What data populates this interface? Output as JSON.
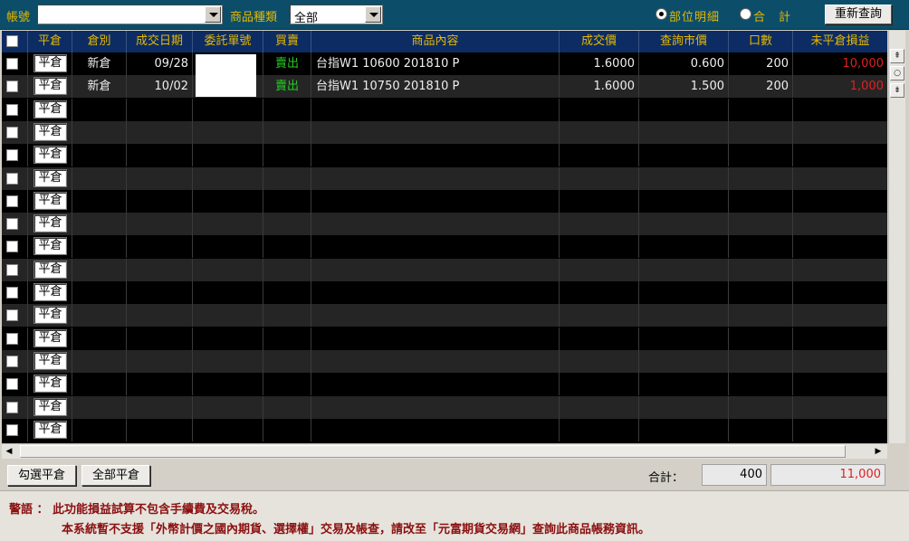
{
  "filter": {
    "account_label": "帳號",
    "account_value": "",
    "product_type_label": "商品種類",
    "product_type_value": "全部",
    "radio_detail_label": "部位明細",
    "radio_total_label": "合　計",
    "requery_label": "重新查詢"
  },
  "columns": [
    "平倉",
    "倉別",
    "成交日期",
    "委託單號",
    "買賣",
    "商品內容",
    "成交價",
    "查詢市價",
    "口數",
    "未平倉損益"
  ],
  "row_button_label": "平倉",
  "rows": [
    {
      "type": "新倉",
      "date": "09/28",
      "order_no": "",
      "side": "賣出",
      "product": "台指W1  10600  201810  P",
      "trade_price": "1.6000",
      "market_price": "0.600",
      "qty": "200",
      "pnl": "10,000"
    },
    {
      "type": "新倉",
      "date": "10/02",
      "order_no": "",
      "side": "賣出",
      "product": "台指W1  10750  201810  P",
      "trade_price": "1.6000",
      "market_price": "1.500",
      "qty": "200",
      "pnl": "1,000"
    }
  ],
  "empty_row_count": 15,
  "bottom": {
    "checked_close_label": "勾選平倉",
    "close_all_label": "全部平倉",
    "total_label": "合計：",
    "total_qty": "400",
    "total_pnl": "11,000"
  },
  "warning": {
    "line1": "警語 ： 此功能損益試算不包含手續費及交易稅。",
    "line2": "本系統暫不支援「外幣計價之國內期貨、選擇權」交易及帳查，請改至「元富期貨交易網」查詢此商品帳務資訊。"
  },
  "colors": {
    "header_bg": "#0c2c63",
    "topbar_bg": "#0c4e69",
    "label_yellow": "#e6b800",
    "sell_green": "#22cc22",
    "pnl_red": "#e02020",
    "warning_red": "#8b0f0f"
  }
}
